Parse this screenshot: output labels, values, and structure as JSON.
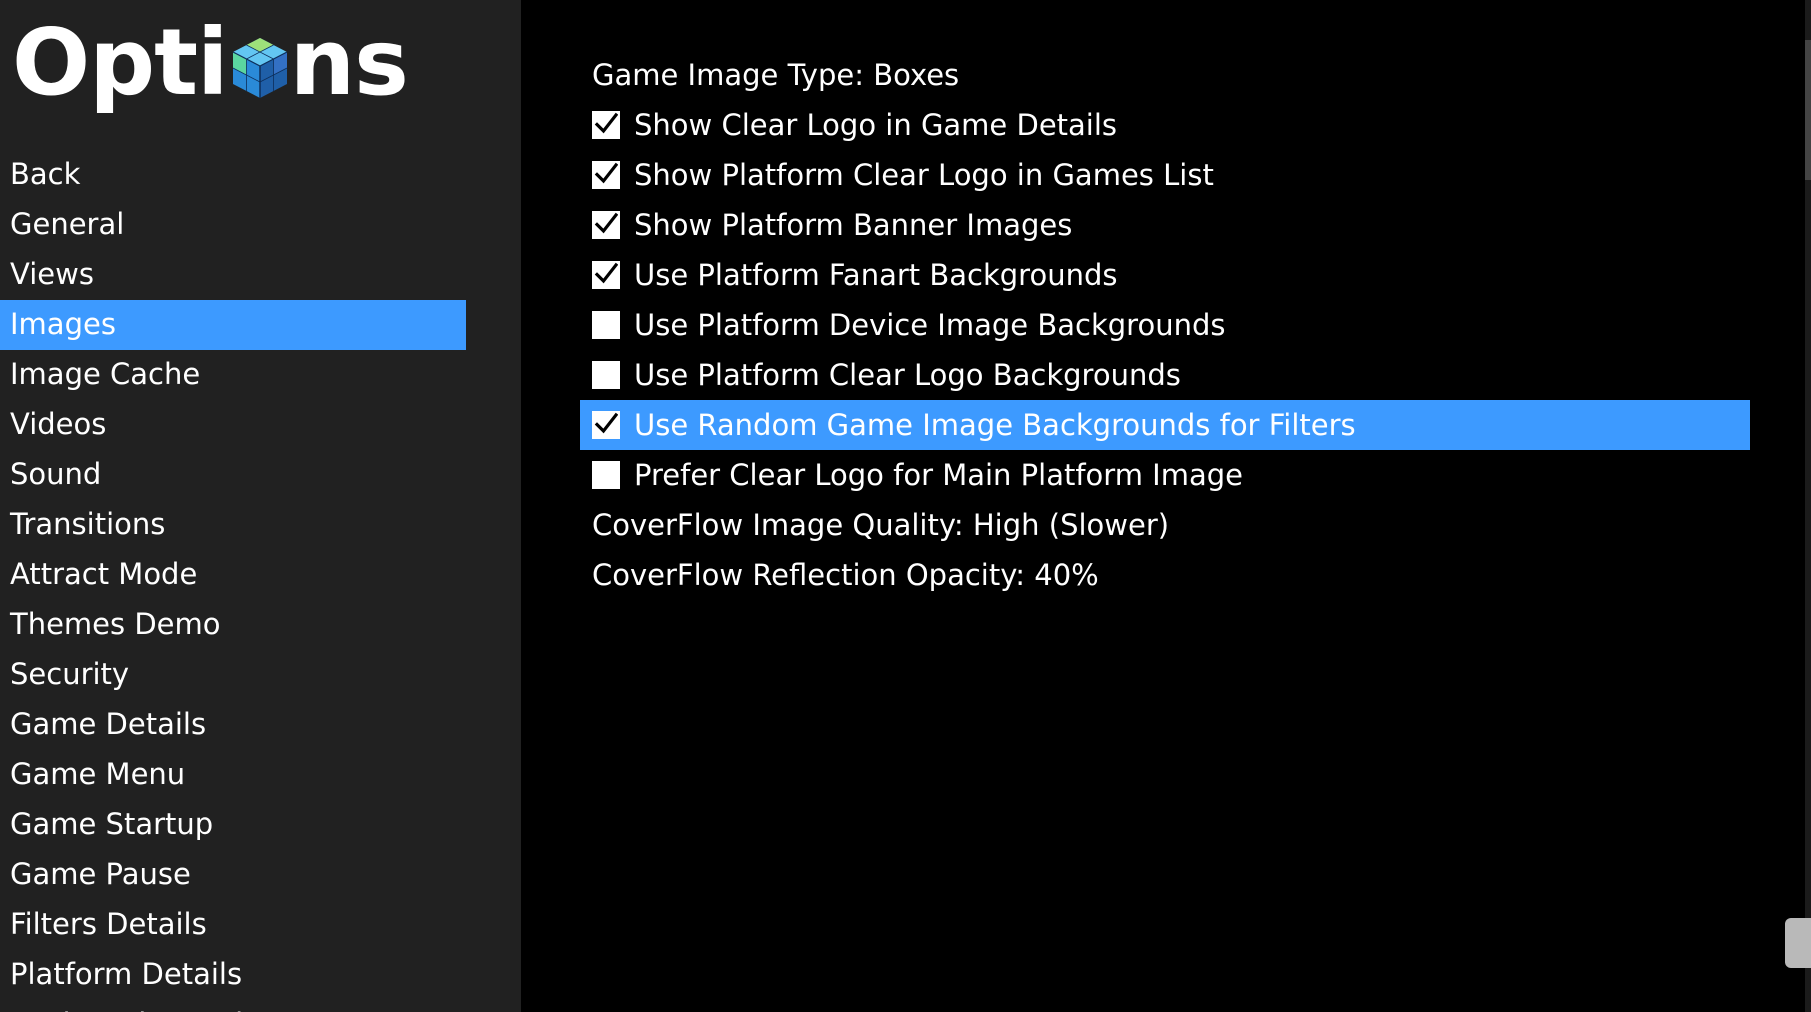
{
  "app": {
    "title": "Options"
  },
  "sidebar": {
    "items": [
      {
        "label": "Back",
        "selected": false
      },
      {
        "label": "General",
        "selected": false
      },
      {
        "label": "Views",
        "selected": false
      },
      {
        "label": "Images",
        "selected": true
      },
      {
        "label": "Image Cache",
        "selected": false
      },
      {
        "label": "Videos",
        "selected": false
      },
      {
        "label": "Sound",
        "selected": false
      },
      {
        "label": "Transitions",
        "selected": false
      },
      {
        "label": "Attract Mode",
        "selected": false
      },
      {
        "label": "Themes Demo",
        "selected": false
      },
      {
        "label": "Security",
        "selected": false
      },
      {
        "label": "Game Details",
        "selected": false
      },
      {
        "label": "Game Menu",
        "selected": false
      },
      {
        "label": "Game Startup",
        "selected": false
      },
      {
        "label": "Game Pause",
        "selected": false
      },
      {
        "label": "Filters Details",
        "selected": false
      },
      {
        "label": "Platform Details",
        "selected": false
      },
      {
        "label": "Keyboard Mapping",
        "selected": false
      }
    ]
  },
  "main": {
    "options": [
      {
        "type": "value",
        "label": "Game Image Type: Boxes"
      },
      {
        "type": "checkbox",
        "label": "Show Clear Logo in Game Details",
        "checked": true
      },
      {
        "type": "checkbox",
        "label": "Show Platform Clear Logo in Games List",
        "checked": true
      },
      {
        "type": "checkbox",
        "label": "Show Platform Banner Images",
        "checked": true
      },
      {
        "type": "checkbox",
        "label": "Use Platform Fanart Backgrounds",
        "checked": true
      },
      {
        "type": "checkbox",
        "label": "Use Platform Device Image Backgrounds",
        "checked": false
      },
      {
        "type": "checkbox",
        "label": "Use Platform Clear Logo Backgrounds",
        "checked": false
      },
      {
        "type": "checkbox",
        "label": "Use Random Game Image Backgrounds for Filters",
        "checked": true,
        "selected": true
      },
      {
        "type": "checkbox",
        "label": "Prefer Clear Logo for Main Platform Image",
        "checked": false
      },
      {
        "type": "value",
        "label": "CoverFlow Image Quality: High (Slower)"
      },
      {
        "type": "value",
        "label": "CoverFlow Reflection Opacity: 40%"
      }
    ]
  },
  "colors": {
    "sidebar_bg": "#212121",
    "main_bg": "#000000",
    "selection": "#3d9aff",
    "text": "#ffffff"
  },
  "icons": {
    "logo_cube": "cube-icon",
    "check": "check-icon"
  }
}
